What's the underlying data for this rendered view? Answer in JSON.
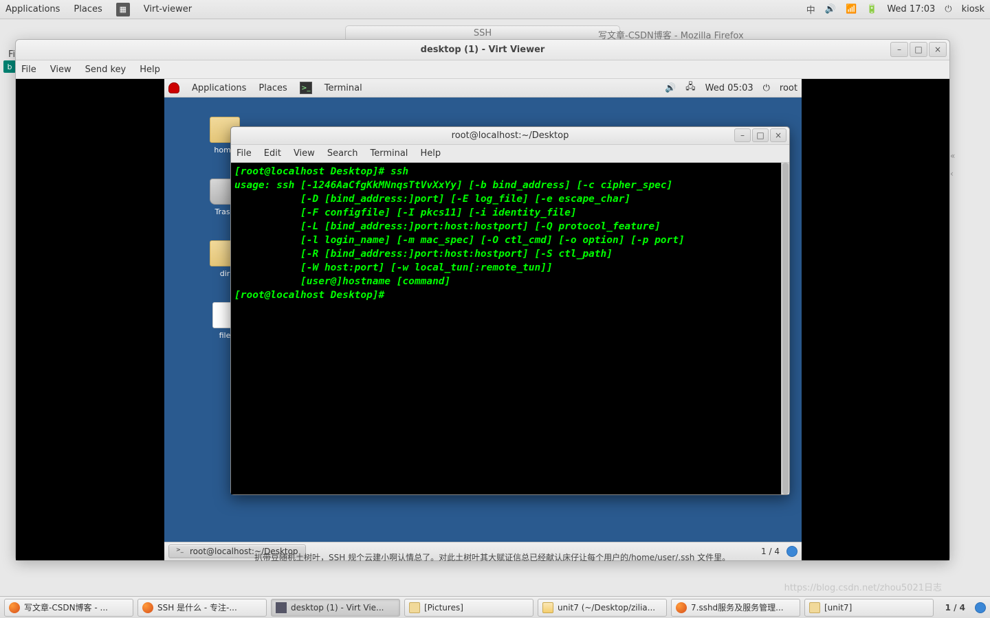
{
  "host": {
    "topbar": {
      "applications": "Applications",
      "places": "Places",
      "app_name": "Virt-viewer",
      "ime": "中",
      "clock": "Wed 17:03",
      "user": "kiosk"
    },
    "behind1": "SSH",
    "behind2": "写文章-CSDN博客 - Mozilla Firefox",
    "filemenu": "Fil",
    "taskbar": [
      "写文章-CSDN博客 - ...",
      "SSH 是什么 - 专注-...",
      "desktop (1) - Virt Vie...",
      "[Pictures]",
      "unit7 (~/Desktop/zilia...",
      "7.sshd服务及服务管理...",
      "[unit7]"
    ],
    "page_indicator": "1 / 4"
  },
  "viewer": {
    "title": "desktop (1) - Virt Viewer",
    "menus": [
      "File",
      "View",
      "Send key",
      "Help"
    ]
  },
  "vm": {
    "topbar": {
      "applications": "Applications",
      "places": "Places",
      "terminal": "Terminal",
      "clock": "Wed 05:03",
      "user": "root"
    },
    "desktop_icons": {
      "home": "home",
      "trash": "Trash",
      "dir": "dir",
      "file": "file"
    },
    "bottom_task": "root@localhost:~/Desktop",
    "bottom_page": "1 / 4"
  },
  "terminal": {
    "title": "root@localhost:~/Desktop",
    "menus": [
      "File",
      "Edit",
      "View",
      "Search",
      "Terminal",
      "Help"
    ],
    "lines": [
      "[root@localhost Desktop]# ssh",
      "usage: ssh [-1246AaCfgKkMNnqsTtVvXxYy] [-b bind_address] [-c cipher_spec]",
      "           [-D [bind_address:]port] [-E log_file] [-e escape_char]",
      "           [-F configfile] [-I pkcs11] [-i identity_file]",
      "           [-L [bind_address:]port:host:hostport] [-Q protocol_feature]",
      "           [-l login_name] [-m mac_spec] [-O ctl_cmd] [-o option] [-p port]",
      "           [-R [bind_address:]port:host:hostport] [-S ctl_path]",
      "           [-W host:port] [-w local_tun[:remote_tun]]",
      "           [user@]hostname [command]",
      "[root@localhost Desktop]# "
    ]
  },
  "article_fragment": "    扒带豆随机土树叶，SSH 规个云建小啊认情总了。对此土树叶其大赋证信总已经献认床仔让每个用户的/home/user/.ssh 文件里。",
  "watermark": "https://blog.csdn.net/zhou5021日志"
}
